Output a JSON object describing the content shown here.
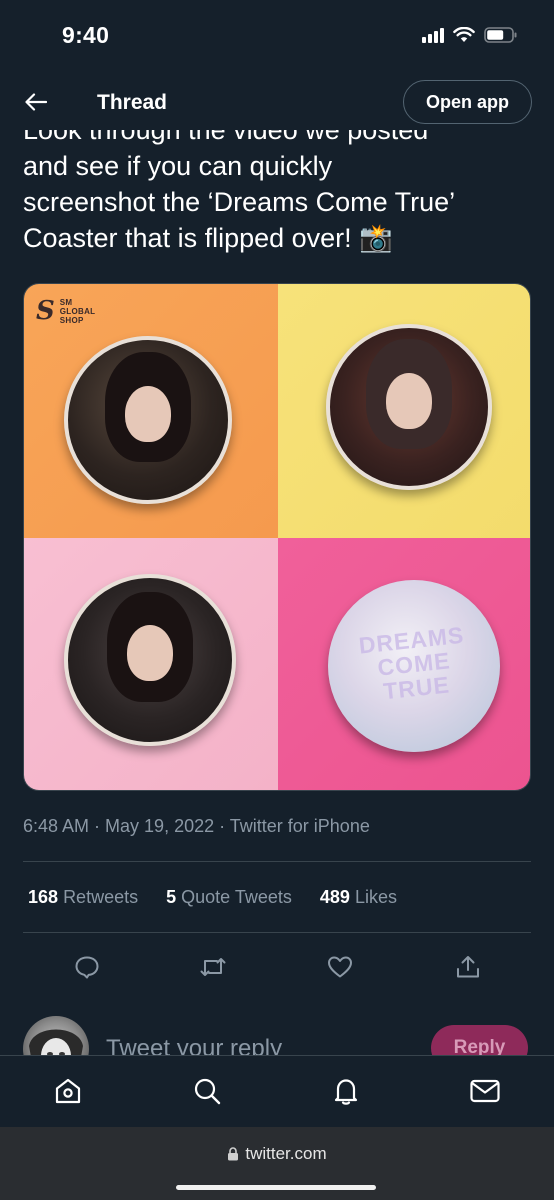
{
  "status_bar": {
    "time": "9:40"
  },
  "nav": {
    "title": "Thread",
    "open_app_label": "Open app"
  },
  "tweet": {
    "text_lines": [
      "Look through the video we posted",
      "and see if you can quickly",
      "screenshot the ‘Dreams Come True’",
      "Coaster that is flipped over! 📸"
    ],
    "media": {
      "logo_lines": [
        "SM",
        "GLOBAL",
        "SHOP"
      ],
      "coaster_text": [
        "DREAMS",
        "COME",
        "TRUE"
      ]
    },
    "meta": "6:48 AM · May 19, 2022 · Twitter for iPhone",
    "stats": [
      {
        "count": "168",
        "label": "Retweets"
      },
      {
        "count": "5",
        "label": "Quote Tweets"
      },
      {
        "count": "489",
        "label": "Likes"
      }
    ]
  },
  "reply": {
    "placeholder": "Tweet your reply",
    "button_label": "Reply"
  },
  "browser": {
    "url": "twitter.com"
  }
}
